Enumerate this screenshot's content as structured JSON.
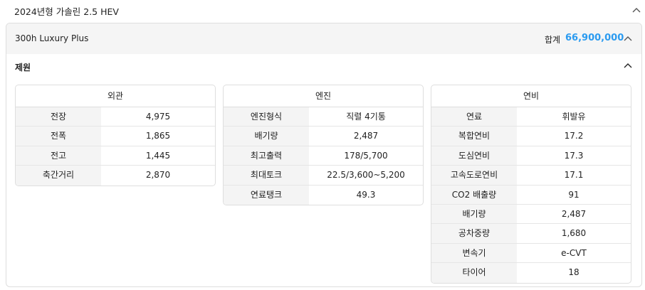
{
  "model": {
    "title": "2024년형 가솔린 2.5 HEV"
  },
  "trim": {
    "name": "300h Luxury Plus",
    "total_label": "합계",
    "total_value": "66,900,000"
  },
  "section": {
    "title": "제원"
  },
  "specs": [
    {
      "title": "외관",
      "rows": [
        {
          "label": "전장",
          "value": "4,975"
        },
        {
          "label": "전폭",
          "value": "1,865"
        },
        {
          "label": "전고",
          "value": "1,445"
        },
        {
          "label": "축간거리",
          "value": "2,870"
        }
      ]
    },
    {
      "title": "엔진",
      "rows": [
        {
          "label": "엔진형식",
          "value": "직렬 4기통"
        },
        {
          "label": "배기량",
          "value": "2,487"
        },
        {
          "label": "최고출력",
          "value": "178/5,700"
        },
        {
          "label": "최대토크",
          "value": "22.5/3,600~5,200"
        },
        {
          "label": "연료탱크",
          "value": "49.3"
        }
      ]
    },
    {
      "title": "연비",
      "rows": [
        {
          "label": "연료",
          "value": "휘발유"
        },
        {
          "label": "복합연비",
          "value": "17.2"
        },
        {
          "label": "도심연비",
          "value": "17.3"
        },
        {
          "label": "고속도로연비",
          "value": "17.1"
        },
        {
          "label": "CO2 배출량",
          "value": "91"
        },
        {
          "label": "배기량",
          "value": "2,487"
        },
        {
          "label": "공차중량",
          "value": "1,680"
        },
        {
          "label": "변속기",
          "value": "e-CVT"
        },
        {
          "label": "타이어",
          "value": "18"
        }
      ]
    }
  ],
  "icons": {
    "collapse": "chevron-up-icon"
  },
  "colors": {
    "accent": "#2b9bf0",
    "header_bg": "#f5f5f5",
    "label_bg": "#f4f4f4",
    "border": "#dedede"
  }
}
